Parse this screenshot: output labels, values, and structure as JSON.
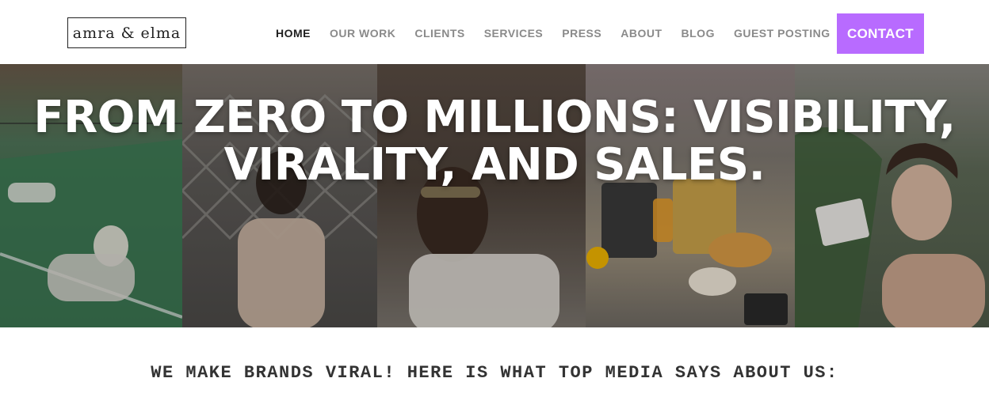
{
  "header": {
    "logo_text": "amra & elma",
    "nav": [
      {
        "label": "HOME",
        "active": true
      },
      {
        "label": "OUR WORK",
        "active": false
      },
      {
        "label": "CLIENTS",
        "active": false
      },
      {
        "label": "SERVICES",
        "active": false
      },
      {
        "label": "PRESS",
        "active": false
      },
      {
        "label": "ABOUT",
        "active": false
      },
      {
        "label": "BLOG",
        "active": false
      },
      {
        "label": "GUEST POSTING",
        "active": false
      }
    ],
    "contact_label": "CONTACT"
  },
  "hero": {
    "title_line1": "FROM ZERO TO MILLIONS: VISIBILITY,",
    "title_line2": "VIRALITY, AND SALES."
  },
  "tagline": "WE MAKE BRANDS VIRAL! HERE IS WHAT TOP MEDIA SAYS ABOUT US:",
  "colors": {
    "accent": "#b86bff",
    "nav_active": "#1f1f1f",
    "nav_inactive": "#8a8a8a"
  }
}
